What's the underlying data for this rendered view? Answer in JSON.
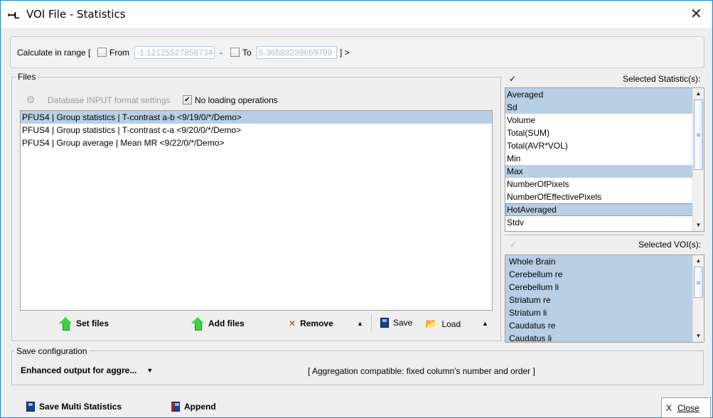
{
  "window": {
    "title": "VOI File - Statistics",
    "app_icon": "pmod-icon",
    "close": "✕"
  },
  "range": {
    "label": "Calculate in range [",
    "from_label": "From",
    "from_value": "-1.12125527858734",
    "dash": "-",
    "to_label": "To",
    "to_value": "5.36588239669799",
    "end": "] >",
    "from_checked": false,
    "to_checked": false
  },
  "files": {
    "title": "Files",
    "db_settings": "Database INPUT format settings",
    "no_loading": "No loading operations",
    "no_loading_checked": true,
    "items": [
      "PFUS4 | Group statistics | T-contrast a-b <9/19/0/*/Demo>",
      "PFUS4 | Group statistics | T-contrast c-a <9/20/0/*/Demo>",
      "PFUS4 | Group average | Mean MR <9/22/0/*/Demo>"
    ],
    "selected_index": 0,
    "set_files": "Set files",
    "add_files": "Add files",
    "remove": "Remove",
    "save": "Save",
    "load": "Load"
  },
  "statistics": {
    "check": "✓",
    "title": "Selected Statistic(s):",
    "items": [
      {
        "label": "Averaged",
        "selected": true
      },
      {
        "label": "Sd",
        "selected": true
      },
      {
        "label": "Volume",
        "selected": false
      },
      {
        "label": "Total(SUM)",
        "selected": false
      },
      {
        "label": "Total(AVR*VOL)",
        "selected": false
      },
      {
        "label": "Min",
        "selected": false
      },
      {
        "label": "Max",
        "selected": true
      },
      {
        "label": "NumberOfPixels",
        "selected": false
      },
      {
        "label": "NumberOfEffectivePixels",
        "selected": false
      },
      {
        "label": "HotAveraged",
        "selected": true
      },
      {
        "label": "Stdv",
        "selected": false
      }
    ]
  },
  "vois": {
    "check": "✓",
    "title": "Selected VOI(s):",
    "items": [
      "Whole Brain",
      "Cerebellum re",
      "Cerebellum li",
      "Striatum re",
      "Striatum li",
      "Caudatus re",
      "Caudatus li"
    ]
  },
  "save_config": {
    "title": "Save configuration",
    "mode": "Enhanced output for aggre...",
    "info": "[ Aggregation compatible: fixed column's number and order ]"
  },
  "footer": {
    "save_multi": "Save Multi Statistics",
    "append": "Append",
    "close": "Close"
  },
  "colors": {
    "selection": "#b8cfe5",
    "window_border": "#1883d7"
  }
}
